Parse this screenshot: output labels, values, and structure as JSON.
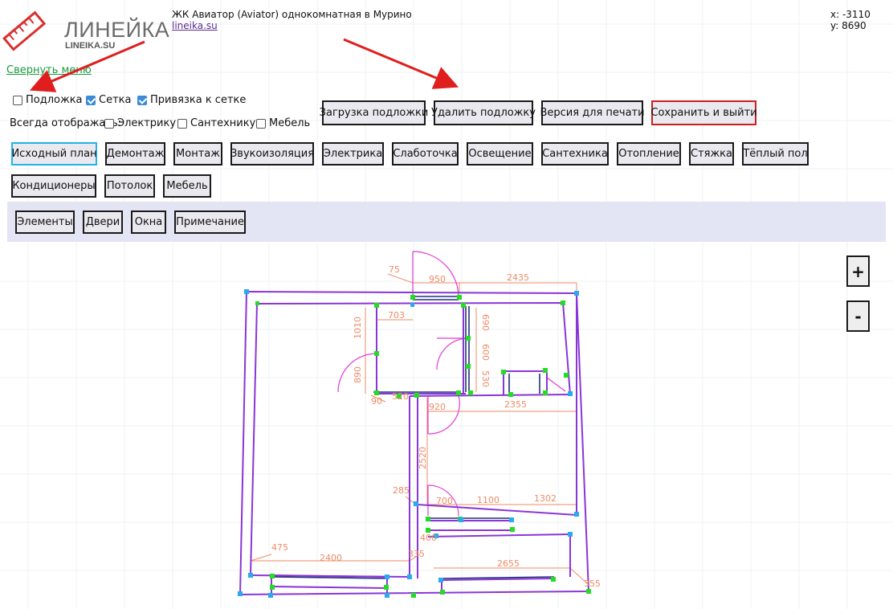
{
  "logo": {
    "title": "ЛИНЕЙКА",
    "subtitle": "LINEIKA.SU"
  },
  "project": {
    "title": "ЖК Авиатор (Aviator) однокомнатная в Мурино",
    "link": "lineika.su"
  },
  "coords": {
    "x_text": "x: -3110",
    "y_text": "y: 8690"
  },
  "menu": {
    "collapse_label": "Свернуть меню"
  },
  "options": {
    "underlay_label": "Подложка",
    "underlay_checked": false,
    "grid_label": "Сетка",
    "grid_checked": true,
    "snap_label": "Привязка к сетке",
    "snap_checked": true,
    "always_show_label": "Всегда отображать:",
    "electric_label": "Электрику",
    "electric_checked": false,
    "plumbing_label": "Сантехнику",
    "plumbing_checked": false,
    "furniture_label": "Мебель",
    "furniture_checked": false
  },
  "actions": {
    "load_underlay": "Загрузка подложки",
    "delete_underlay": "Удалить подложку",
    "print_version": "Версия для печати",
    "save_exit": "Сохранить и выйти"
  },
  "plan_tabs": [
    "Исходный план",
    "Демонтаж",
    "Монтаж",
    "Звукоизоляция",
    "Электрика",
    "Слаботочка",
    "Освещение",
    "Сантехника",
    "Отопление",
    "Стяжка",
    "Тёплый пол",
    "Кондиционеры",
    "Потолок",
    "Мебель"
  ],
  "active_tab": "Исходный план",
  "element_tabs": [
    "Элементы",
    "Двери",
    "Окна",
    "Примечание"
  ],
  "zoom": {
    "in_label": "+",
    "out_label": "-"
  },
  "dimensions": [
    "75",
    "950",
    "2435",
    "703",
    "1010",
    "690",
    "600",
    "890",
    "530",
    "90",
    "520",
    "920",
    "2355",
    "2520",
    "285",
    "700",
    "1100",
    "1302",
    "475",
    "2400",
    "400",
    "335",
    "2655",
    "355"
  ],
  "colors": {
    "wall": "#8a35d6",
    "dimension": "#f08a65",
    "door_arc": "#e23ad8",
    "node_green": "#22dd22",
    "node_blue": "#2aa9f0",
    "grid": "#eef0f4",
    "active_border": "#22b4e6",
    "save_border": "#cc1f1f",
    "panel_bg": "#e3e5f5"
  }
}
